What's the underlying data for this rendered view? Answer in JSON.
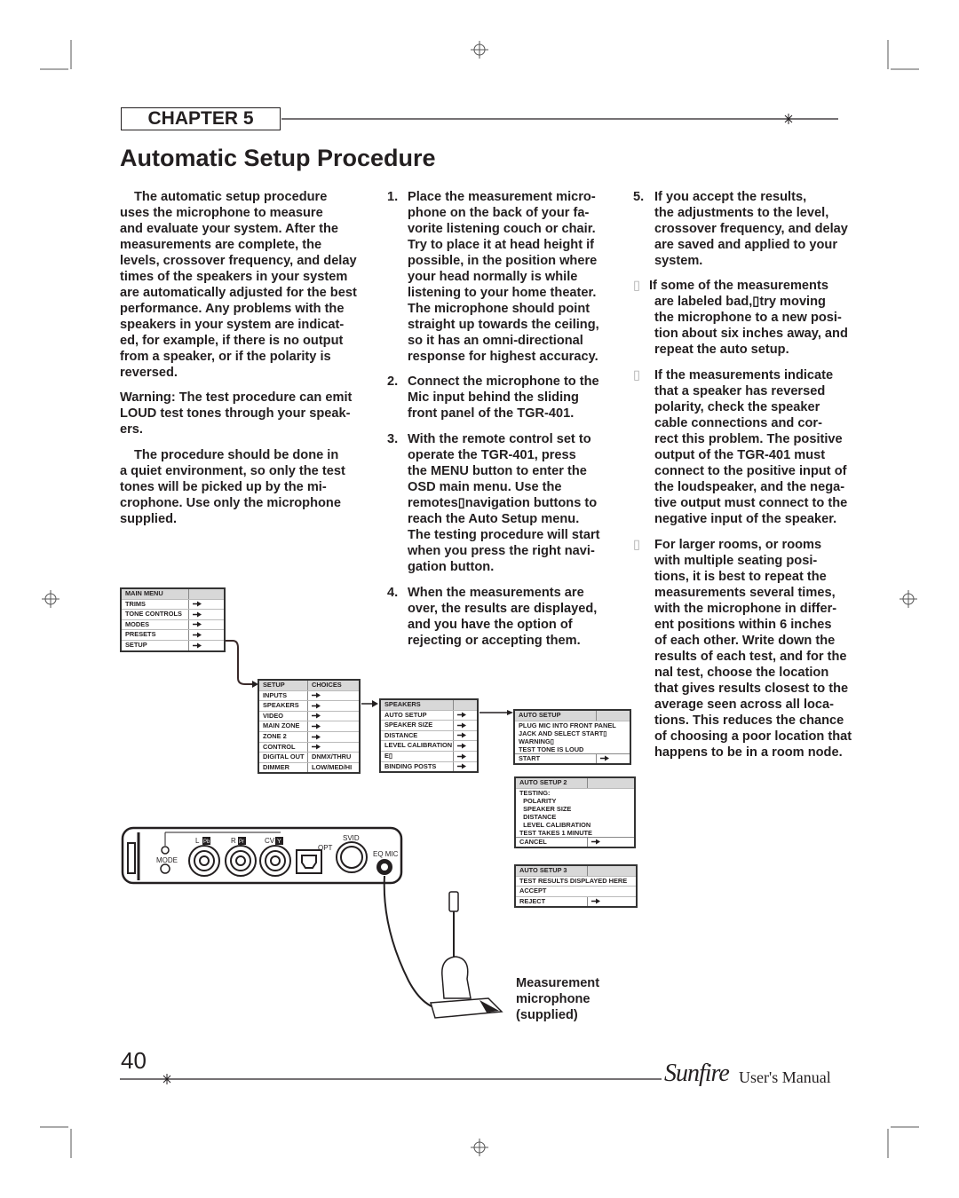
{
  "header": {
    "chapter": "CHAPTER 5",
    "title": "Automatic Setup Procedure"
  },
  "column1": {
    "paragraphs": [
      [
        "The automatic setup procedure",
        "uses the microphone to measure",
        "and evaluate your system. After the",
        "measurements are complete, the",
        "levels, crossover frequency, and delay",
        "times of the speakers in your system",
        "are automatically adjusted for the best",
        "performance. Any problems with the",
        "speakers in your system are indicat-",
        "ed, for example, if there is no output",
        "from a speaker, or if the polarity is",
        "reversed."
      ],
      [
        "Warning: The test procedure can emit",
        "LOUD test tones through your speak-",
        "ers."
      ],
      [
        "The procedure should be done in",
        "a quiet environment, so only the test",
        "tones will be picked up by the mi-",
        "crophone. Use only the microphone",
        "supplied."
      ]
    ]
  },
  "column2": {
    "steps": [
      {
        "num": "1.",
        "lines": [
          "Place the measurement micro-",
          "phone on the back of your fa-",
          "vorite listening couch or chair.",
          "Try to place it at head height if",
          "possible, in the position where",
          "your head normally is while",
          "listening to your home theater.",
          "The microphone should point",
          "straight up towards the ceiling,",
          "so it has an omni-directional",
          "response for highest accuracy."
        ]
      },
      {
        "num": "2.",
        "lines": [
          "Connect the microphone to the",
          "Mic input behind the sliding",
          "front panel of the TGR-401."
        ]
      },
      {
        "num": "3.",
        "lines": [
          "With the remote control set to",
          "operate the TGR-401, press",
          "the MENU button to enter the",
          "OSD main menu. Use the",
          "remotes▯navigation buttons to",
          "reach the Auto Setup menu.",
          "The testing procedure will start",
          "when you press the right navi-",
          "gation button."
        ]
      },
      {
        "num": "4.",
        "lines": [
          "When the measurements are",
          "over, the results are displayed,",
          "and you have the option of",
          "rejecting or accepting them."
        ]
      }
    ]
  },
  "column3": {
    "steps": [
      {
        "num": "5.",
        "lines": [
          "If you accept the results,",
          "the adjustments to the level,",
          "crossover frequency, and delay",
          "are saved and applied to your",
          "system."
        ]
      },
      {
        "num": "▯",
        "lines": [
          "If some of the measurements",
          "are labeled bad,▯try moving",
          "the microphone to a new posi-",
          "tion about six inches away, and",
          "repeat the auto setup."
        ]
      },
      {
        "num": "▯",
        "lines": [
          "If the measurements indicate",
          "that a speaker has reversed",
          "polarity, check the speaker",
          "cable connections and cor-",
          "rect this problem. The positive",
          "output of the TGR-401 must",
          "connect to the positive input of",
          "the loudspeaker, and the nega-",
          "tive output must connect to the",
          "negative input of the speaker."
        ]
      },
      {
        "num": "▯",
        "lines": [
          "For larger rooms, or rooms",
          "with multiple seating posi-",
          "tions, it is best to repeat the",
          "measurements several times,",
          "with the microphone in differ-",
          "ent positions within 6 inches",
          "of each other. Write down the",
          "results of each test, and for the",
          "nal test, choose the location",
          "that gives results closest to the",
          "average seen across all loca-",
          "tions. This reduces the chance",
          "of choosing a poor location that",
          "happens to be in a room node."
        ]
      }
    ]
  },
  "menus": [
    {
      "id": "main-menu",
      "rows": [
        {
          "label": "MAIN MENU",
          "value": "",
          "header": true
        },
        {
          "label": "TRIMS",
          "arrow": true
        },
        {
          "label": "TONE CONTROLS",
          "arrow": true
        },
        {
          "label": "MODES",
          "arrow": true
        },
        {
          "label": "PRESETS",
          "arrow": true
        },
        {
          "label": "SETUP",
          "arrow": true
        }
      ]
    },
    {
      "id": "setup-menu",
      "rows": [
        {
          "label": "SETUP",
          "value": "CHOICES",
          "header": true
        },
        {
          "label": "INPUTS",
          "arrow": true
        },
        {
          "label": "SPEAKERS",
          "arrow": true
        },
        {
          "label": "VIDEO",
          "arrow": true
        },
        {
          "label": "MAIN ZONE",
          "arrow": true
        },
        {
          "label": "ZONE 2",
          "arrow": true
        },
        {
          "label": "CONTROL",
          "arrow": true
        },
        {
          "label": "DIGITAL OUT",
          "value": "DNMX/THRU"
        },
        {
          "label": "DIMMER",
          "value": "LOW/MED/HI"
        }
      ]
    },
    {
      "id": "speakers-menu",
      "rows": [
        {
          "label": "SPEAKERS",
          "value": "",
          "header": true
        },
        {
          "label": "AUTO SETUP",
          "arrow": true
        },
        {
          "label": "SPEAKER SIZE",
          "arrow": true
        },
        {
          "label": "DISTANCE",
          "arrow": true
        },
        {
          "label": "LEVEL CALIBRATION",
          "arrow": true
        },
        {
          "label": "E▯",
          "arrow": true
        },
        {
          "label": "BINDING POSTS",
          "arrow": true
        }
      ]
    },
    {
      "id": "auto-setup-menu",
      "rows": [
        {
          "label": "AUTO SETUP",
          "value": "",
          "header": true
        },
        {
          "label": "PLUG MIC INTO FRONT PANEL",
          "text": true
        },
        {
          "label": "JACK AND SELECT START▯",
          "text": true
        },
        {
          "label": "WARNING▯",
          "text": true
        },
        {
          "label": "TEST TONE IS LOUD",
          "text": true,
          "last": true
        },
        {
          "label": "START",
          "arrow": true
        }
      ]
    },
    {
      "id": "auto-setup-2-menu",
      "rows": [
        {
          "label": "AUTO SETUP 2",
          "value": "",
          "header": true
        },
        {
          "label": "TESTING:",
          "text": true
        },
        {
          "label": "  POLARITY",
          "text": true
        },
        {
          "label": "  SPEAKER SIZE",
          "text": true
        },
        {
          "label": "  DISTANCE",
          "text": true
        },
        {
          "label": "  LEVEL CALIBRATION",
          "text": true
        },
        {
          "label": "TEST TAKES 1 MINUTE",
          "text": true,
          "last": true
        },
        {
          "label": "CANCEL",
          "arrow": true
        }
      ]
    },
    {
      "id": "auto-setup-3-menu",
      "rows": [
        {
          "label": "AUTO SETUP 3",
          "value": "",
          "header": true
        },
        {
          "label": "TEST RESULTS DISPLAYED HERE",
          "full": true
        },
        {
          "label": "ACCEPT",
          "full": true
        },
        {
          "label": "REJECT",
          "arrow": true
        }
      ]
    }
  ],
  "panel": {
    "labels": {
      "l": "L",
      "pb": "Pb",
      "r": "R",
      "pr": "Pr",
      "cv": "CV",
      "y": "Y",
      "opt": "OPT",
      "svid": "SVID",
      "eq_mic": "EQ MIC",
      "mode": "MODE"
    }
  },
  "caption": [
    "Measurement",
    "microphone",
    "(supplied)"
  ],
  "footer": {
    "page_number": "40",
    "brand": "Sunfire",
    "manual": "User's Manual"
  }
}
